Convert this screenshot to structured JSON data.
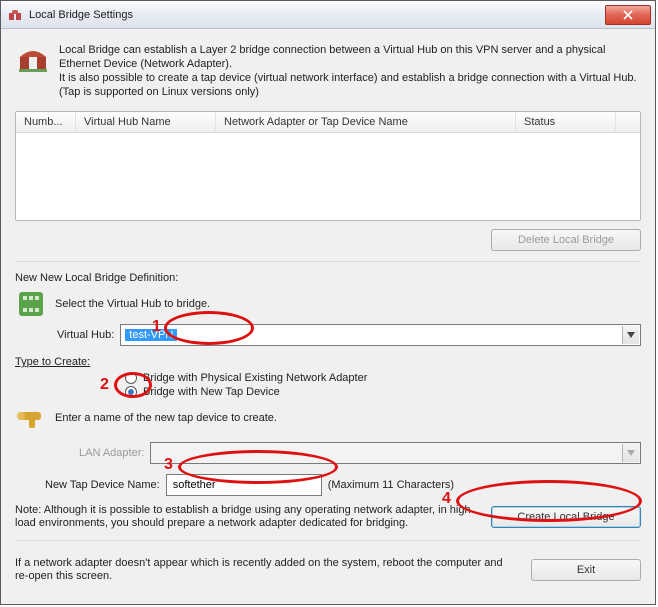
{
  "window": {
    "title": "Local Bridge Settings",
    "close_label": "Close"
  },
  "intro": {
    "text": "Local Bridge can establish a Layer 2 bridge connection between a Virtual Hub on this VPN server and a physical Ethernet Device (Network Adapter).\nIt is also possible to create a tap device (virtual network interface) and establish a bridge connection with a Virtual Hub. (Tap is supported on Linux versions only)"
  },
  "table": {
    "h0": "Numb...",
    "h1": "Virtual Hub Name",
    "h2": "Network Adapter or Tap Device Name",
    "h3": "Status"
  },
  "buttons": {
    "delete": "Delete Local Bridge",
    "create": "Create Local Bridge",
    "exit": "Exit"
  },
  "def": {
    "title": "New New Local Bridge Definition:",
    "select": "Select the Virtual Hub to bridge.",
    "hub_label": "Virtual Hub:",
    "hub_value": "test-VPN",
    "type_label": "Type to Create:",
    "radio_phys": "Bridge with Physical Existing Network Adapter",
    "radio_tap": "Bridge with New Tap Device",
    "enter_name": "Enter a name of the new tap device to create.",
    "lan_label": "LAN Adapter:",
    "tap_label": "New Tap Device Name:",
    "tap_value": "softether",
    "max_chars": "(Maximum 11 Characters)",
    "note": "Note: Although it is possible to establish a bridge using any operating network adapter, in high load environments, you should prepare a network adapter dedicated for bridging."
  },
  "footer": {
    "text": "If a network adapter doesn't appear which is recently added on the system, reboot the computer and re-open this screen."
  },
  "ann": {
    "n1": "1",
    "n2": "2",
    "n3": "3",
    "n4": "4"
  }
}
